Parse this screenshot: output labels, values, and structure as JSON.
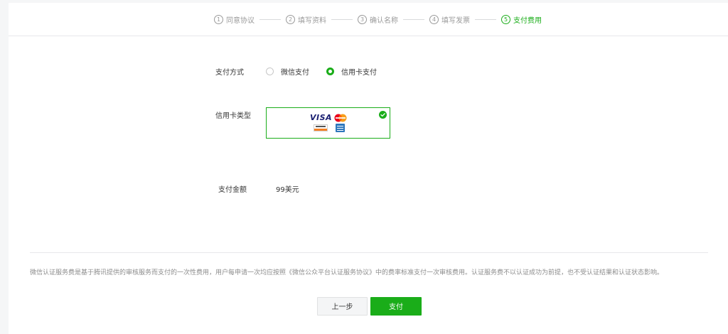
{
  "steps": [
    {
      "num": "1",
      "label": "同意协议"
    },
    {
      "num": "2",
      "label": "填写资料"
    },
    {
      "num": "3",
      "label": "确认名称"
    },
    {
      "num": "4",
      "label": "填写发票"
    },
    {
      "num": "5",
      "label": "支付费用"
    }
  ],
  "active_step": 5,
  "payment": {
    "method_label": "支付方式",
    "options": [
      "微信支付",
      "信用卡支付"
    ],
    "selected": "信用卡支付",
    "card_type_label": "信用卡类型",
    "card_brands": {
      "visa": "VISA",
      "icons": [
        "visa-logo",
        "mastercard-logo",
        "discover-logo",
        "amex-logo"
      ]
    },
    "amount_label": "支付金额",
    "amount_value": "99美元"
  },
  "notice": "微信认证服务费是基于腾讯提供的审核服务而支付的一次性费用，用户每申请一次均应按照《微信公众平台认证服务协议》中的费率标准支付一次审核费用。认证服务费不以认证成功为前提，也不受认证结果和认证状态影响。",
  "buttons": {
    "prev": "上一步",
    "pay": "支付"
  },
  "colors": {
    "accent": "#1aad19",
    "muted": "#9a9a9a",
    "text": "#353535"
  }
}
